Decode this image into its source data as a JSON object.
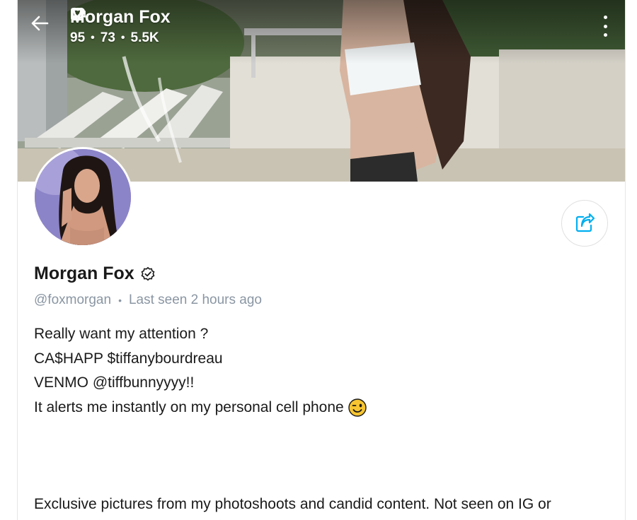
{
  "header": {
    "name": "Morgan Fox",
    "photos_count": "95",
    "videos_count": "73",
    "likes_count": "5.5K"
  },
  "profile": {
    "name": "Morgan Fox",
    "handle": "@foxmorgan",
    "last_seen": "Last seen 2 hours ago"
  },
  "bio": {
    "line1": "Really want my attention ?",
    "line2": "CA$HAPP $tiffanybourdreau",
    "line3": "VENMO @tiffbunnyyyy!!",
    "line4": "It alerts me instantly on my personal cell phone",
    "line5": "Exclusive pictures from my photoshoots and candid content. Not seen on IG or"
  },
  "icons": {
    "back": "back-arrow-icon",
    "verified": "verified-badge-icon",
    "photos": "image-icon",
    "videos": "video-icon",
    "likes": "heart-icon",
    "more": "more-vertical-icon",
    "share": "share-icon",
    "emoji": "winking-face-emoji"
  },
  "colors": {
    "accent": "#00aff0",
    "text": "#1a1a1a",
    "muted": "#8a96a3"
  }
}
